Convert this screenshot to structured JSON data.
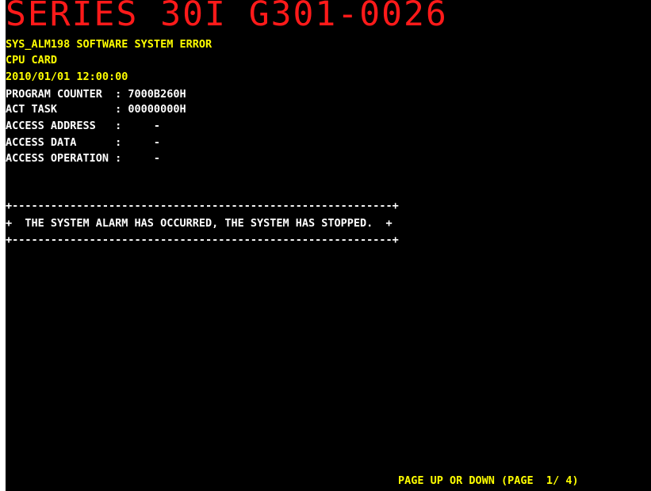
{
  "header": {
    "title": "SERIES 30I G301-0026"
  },
  "alarm": {
    "code_line": "SYS_ALM198 SOFTWARE SYSTEM ERROR",
    "card": "CPU CARD",
    "timestamp": "2010/01/01 12:00:00"
  },
  "registers": {
    "program_counter": "PROGRAM COUNTER  : 7000B260H",
    "act_task": "ACT TASK         : 00000000H",
    "access_address": "ACCESS ADDRESS   :     -",
    "access_data": "ACCESS DATA      :     -",
    "access_operation": "ACCESS OPERATION :     -"
  },
  "message_box": {
    "top_border": "+-----------------------------------------------------------+",
    "message": "+  THE SYSTEM ALARM HAS OCCURRED, THE SYSTEM HAS STOPPED.  +",
    "bottom_border": "+-----------------------------------------------------------+"
  },
  "footer": {
    "paging": "PAGE UP OR DOWN (PAGE  1/ 4)"
  },
  "colors": {
    "background": "#000000",
    "title": "#ff1a1a",
    "highlight": "#ffff00",
    "text": "#ffffff"
  }
}
